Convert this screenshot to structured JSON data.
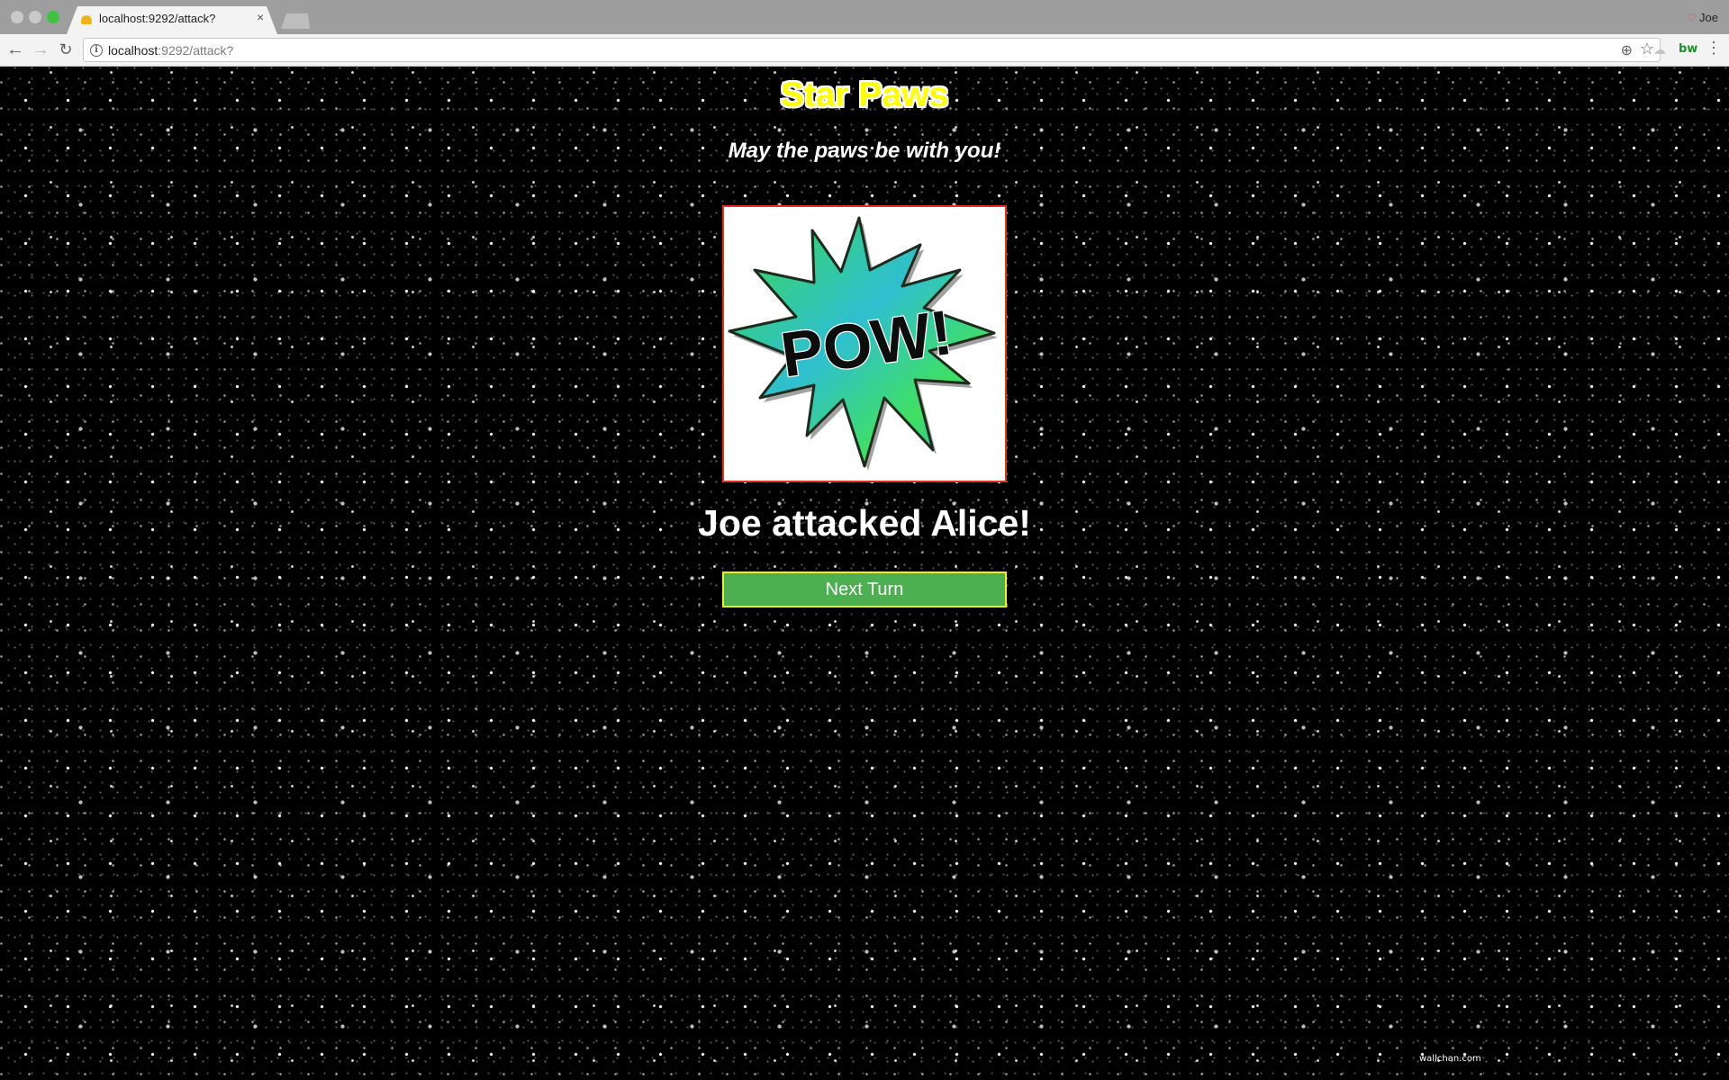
{
  "browser": {
    "tab_title": "localhost:9292/attack?",
    "tab_close": "×",
    "url_host": "localhost",
    "url_rest": ":9292/attack?",
    "profile_name": "Joe",
    "extension_label": "bw",
    "icons": {
      "back": "←",
      "forward": "→",
      "reload": "↻",
      "info": "i",
      "zoom": "⊕",
      "star": "☆",
      "menu": "⋮",
      "cloud": "☁",
      "profile": "♡"
    }
  },
  "page": {
    "title": "Star Paws",
    "tagline": "May the paws be with you!",
    "image_text": "POW!",
    "message": "Joe attacked Alice!",
    "next_button_label": "Next Turn",
    "watermark": "wallchan.com"
  },
  "colors": {
    "title_fill": "#ffff00",
    "button_bg": "#4caf50",
    "button_border": "#f2ee22",
    "image_border": "#e0301e"
  }
}
